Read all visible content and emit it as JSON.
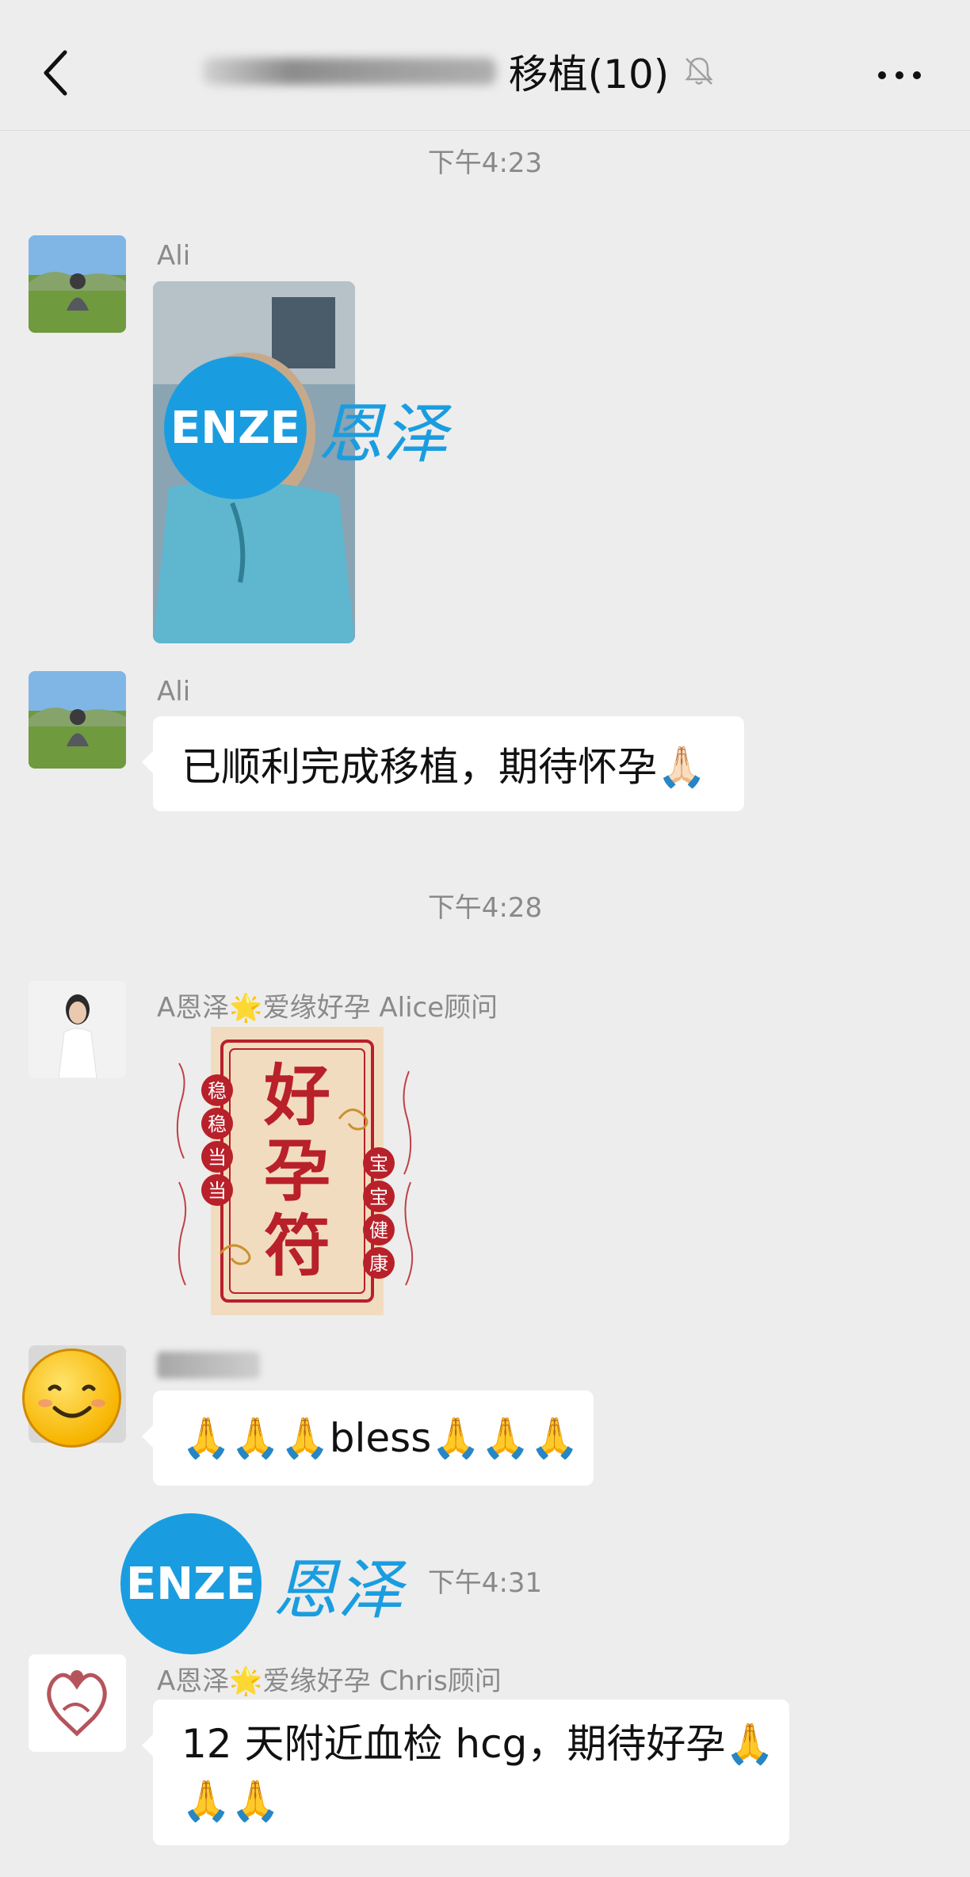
{
  "header": {
    "title": "移植(10)",
    "back_icon": "chevron-left-icon",
    "mute_icon": "bell-off-icon",
    "more_icon": "more-horizontal-icon"
  },
  "timestamps": [
    "下午4:23",
    "下午4:28",
    "下午4:31"
  ],
  "messages": [
    {
      "sender": "Ali",
      "type": "image"
    },
    {
      "sender": "Ali",
      "type": "text",
      "text": "已顺利完成移植，期待怀孕🙏🏻"
    },
    {
      "sender": "A恩泽🌟爱缘好孕 Alice顾问",
      "type": "sticker"
    },
    {
      "sender": "",
      "type": "text",
      "text": "🙏🙏🙏bless🙏🙏🙏"
    },
    {
      "sender": "A恩泽🌟爱缘好孕 Chris顾问",
      "type": "text",
      "text_line1": "12 天附近血检 hcg，期待好孕🙏",
      "text_line2": "🙏🙏"
    }
  ],
  "watermark": {
    "logo_text": "ENZE",
    "cn_text": "恩泽"
  },
  "sticker": {
    "main_text": [
      "好",
      "孕",
      "符"
    ],
    "left_text": [
      "稳",
      "稳",
      "当",
      "当"
    ],
    "right_text": [
      "宝",
      "宝",
      "健",
      "康"
    ]
  },
  "colors": {
    "background": "#ededed",
    "bubble": "#ffffff",
    "watermark_blue": "#1a9de0",
    "sticker_red": "#b8202a"
  }
}
